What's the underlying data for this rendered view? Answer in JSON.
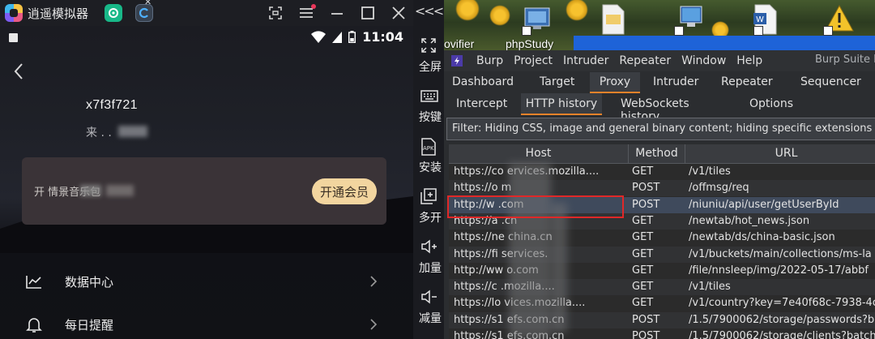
{
  "emulator": {
    "title": "逍遥模拟器",
    "status_time": "11:04",
    "profile": {
      "username": "x7f3f721",
      "subtitle": "来 . ."
    },
    "vip": {
      "text": "开          情景音乐包",
      "button": "开通会员"
    },
    "menu": [
      {
        "label": "数据中心",
        "icon": "chart-line-icon"
      },
      {
        "label": "每日提醒",
        "icon": "bell-icon"
      }
    ],
    "sidebar_top": "<<<",
    "sidebar": [
      {
        "label": "全屏",
        "icon": "fullscreen-icon"
      },
      {
        "label": "按键",
        "icon": "keyboard-icon"
      },
      {
        "label": "安装",
        "icon": "apk-icon"
      },
      {
        "label": "多开",
        "icon": "multi-instance-icon"
      },
      {
        "label": "加量",
        "icon": "volume-up-icon"
      },
      {
        "label": "减量",
        "icon": "volume-down-icon"
      }
    ]
  },
  "desktop": {
    "icons": [
      {
        "label": "ovifier",
        "icon": "app-icon"
      },
      {
        "label": "phpStudy",
        "icon": "phpstudy-icon"
      }
    ]
  },
  "burp": {
    "menu": [
      "Burp",
      "Project",
      "Intruder",
      "Repeater",
      "Window",
      "Help"
    ],
    "brand": "Burp Suite P",
    "tabs_main": [
      "Dashboard",
      "Target",
      "Proxy",
      "Intruder",
      "Repeater",
      "Sequencer"
    ],
    "active_main": "Proxy",
    "tabs_proxy": [
      "Intercept",
      "HTTP history",
      "WebSockets history",
      "Options"
    ],
    "active_proxy": "HTTP history",
    "filter": "Filter: Hiding CSS, image and general binary content;  hiding specific extensions",
    "columns": {
      "host": "Host",
      "method": "Method",
      "url": "URL"
    },
    "rows": [
      {
        "host": "https://co             ervices.mozilla....",
        "method": "GET",
        "url": "/v1/tiles"
      },
      {
        "host": "https://o                            m",
        "method": "POST",
        "url": "/offmsg/req"
      },
      {
        "host": "http://w                       .com",
        "method": "POST",
        "url": "/niuniu/api/user/getUserById"
      },
      {
        "host": "https://a                     .cn",
        "method": "GET",
        "url": "/newtab/hot_news.json"
      },
      {
        "host": "https://ne               china.cn",
        "method": "GET",
        "url": "/newtab/ds/china-basic.json"
      },
      {
        "host": "https://fi             services.",
        "method": "GET",
        "url": "/v1/buckets/main/collections/ms-la"
      },
      {
        "host": "http://ww                 o.com",
        "method": "GET",
        "url": "/file/nnsleep/img/2022-05-17/abbf"
      },
      {
        "host": "https://c              .mozilla....",
        "method": "GET",
        "url": "/v1/tiles"
      },
      {
        "host": "https://lo            vices.mozilla....",
        "method": "GET",
        "url": "/v1/country?key=7e40f68c-7938-4c"
      },
      {
        "host": "https://s1               efs.com.cn",
        "method": "POST",
        "url": "/1.5/7900062/storage/passwords?b"
      },
      {
        "host": "https://s1               efs.com.cn",
        "method": "POST",
        "url": "/1.5/7900062/storage/clients?batch"
      }
    ],
    "selected_row": 2
  }
}
